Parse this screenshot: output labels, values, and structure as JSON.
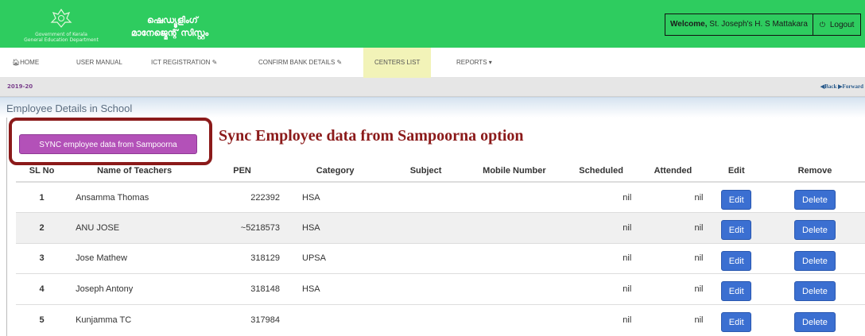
{
  "header": {
    "gov_line1": "Government of Kerala",
    "gov_line2": "General Education Department",
    "app_title_line1": "ഷെഡ്യൂളിംഗ്",
    "app_title_line2": "മാനേജ്മെന്റ് സിസ്റ്റം",
    "welcome_prefix": "Welcome,",
    "welcome_name": "St. Joseph's H. S Mattakara",
    "logout_label": "Logout",
    "emblem_icon": "kerala-emblem-icon",
    "logout_icon": "power-icon",
    "brand_color": "#2ecc5f"
  },
  "nav": {
    "items": [
      {
        "label": "HOME",
        "icon": "home-icon"
      },
      {
        "label": "USER MANUAL"
      },
      {
        "label": "ICT REGISTRATION",
        "icon": "pencil-icon"
      },
      {
        "label": "CONFIRM BANK DETAILS",
        "icon": "pencil-icon"
      },
      {
        "label": "CENTERS LIST",
        "active": true
      },
      {
        "label": "REPORTS",
        "icon": "caret-down-icon"
      }
    ]
  },
  "yearbar": {
    "year": "2019-20",
    "back_label": "Back",
    "forward_label": "Forward"
  },
  "section": {
    "title": "Employee Details in School",
    "sync_button_label": "SYNC employee data from Sampoorna",
    "annotation": "Sync Employee data from Sampoorna option"
  },
  "table": {
    "headers": [
      "SL No",
      "Name of Teachers",
      "PEN",
      "Category",
      "Subject",
      "Mobile Number",
      "Scheduled",
      "Attended",
      "Edit",
      "Remove"
    ],
    "edit_label": "Edit",
    "delete_label": "Delete",
    "rows": [
      {
        "sl": "1",
        "name": "Ansamma Thomas",
        "pen": "222392",
        "category": "HSA",
        "subject": "",
        "mobile": "",
        "scheduled": "nil",
        "attended": "nil"
      },
      {
        "sl": "2",
        "name": "ANU JOSE",
        "pen": "~5218573",
        "category": "HSA",
        "subject": "",
        "mobile": "",
        "scheduled": "nil",
        "attended": "nil"
      },
      {
        "sl": "3",
        "name": "Jose Mathew",
        "pen": "318129",
        "category": "UPSA",
        "subject": "",
        "mobile": "",
        "scheduled": "nil",
        "attended": "nil"
      },
      {
        "sl": "4",
        "name": "Joseph Antony",
        "pen": "318148",
        "category": "HSA",
        "subject": "",
        "mobile": "",
        "scheduled": "nil",
        "attended": "nil"
      },
      {
        "sl": "5",
        "name": "Kunjamma TC",
        "pen": "317984",
        "category": "",
        "subject": "",
        "mobile": "",
        "scheduled": "nil",
        "attended": "nil"
      }
    ]
  }
}
